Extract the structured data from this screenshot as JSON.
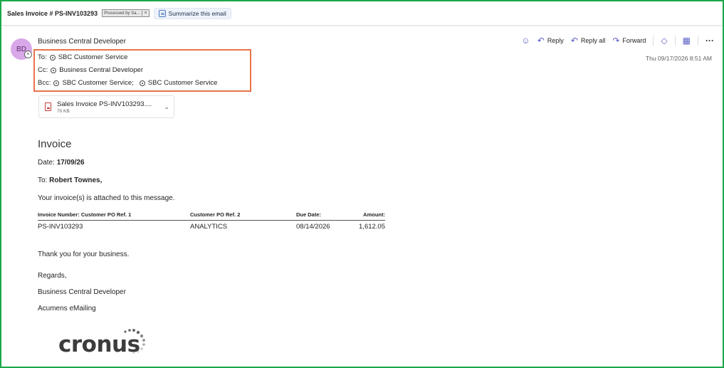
{
  "subject": {
    "title": "Sales Invoice # PS-INV103293",
    "tag_label": "Processed by Sa...",
    "tag_close": "×",
    "summarize_label": "Summarize this email"
  },
  "sender": {
    "initials": "BD",
    "name": "Business Central Developer"
  },
  "recipients": {
    "to_label": "To:",
    "to": [
      "SBC Customer Service"
    ],
    "cc_label": "Cc:",
    "cc": [
      "Business Central Developer"
    ],
    "bcc_label": "Bcc:",
    "bcc": [
      "SBC Customer Service;",
      "SBC Customer Service"
    ]
  },
  "actions": {
    "reply": "Reply",
    "reply_all": "Reply all",
    "forward": "Forward",
    "more": "···"
  },
  "date": "Thu 09/17/2026 8:51 AM",
  "attachment": {
    "name": "Sales Invoice PS-INV103293....",
    "size": "70 KB"
  },
  "body": {
    "heading": "Invoice",
    "date_label": "Date:",
    "date_value": "17/09/26",
    "to_label": "To:",
    "to_value": "Robert Townes,",
    "attached_text": "Your invoice(s) is attached to this message.",
    "table_headers": [
      "Invoice Number: Customer PO Ref. 1",
      "Customer PO Ref. 2",
      "Due Date:",
      "Amount:"
    ],
    "table_rows": [
      [
        "PS-INV103293",
        "ANALYTICS",
        "08/14/2026",
        "1,612.05"
      ]
    ],
    "thanks": "Thank you for your business.",
    "regards": "Regards,",
    "sig_name": "Business Central Developer",
    "sig_company": "Acumens eMailing",
    "logo_text": "cronus"
  },
  "colors": {
    "frame": "#1aa84a",
    "highlight": "#e8734a",
    "avatar": "#d9a8e8",
    "accent": "#5b5fc7"
  },
  "icons": [
    "emoji-icon",
    "reply-icon",
    "reply-all-icon",
    "forward-icon",
    "immersive-reader-icon",
    "apps-icon",
    "more-icon",
    "pdf-icon",
    "chevron-down-icon",
    "summarize-icon"
  ]
}
